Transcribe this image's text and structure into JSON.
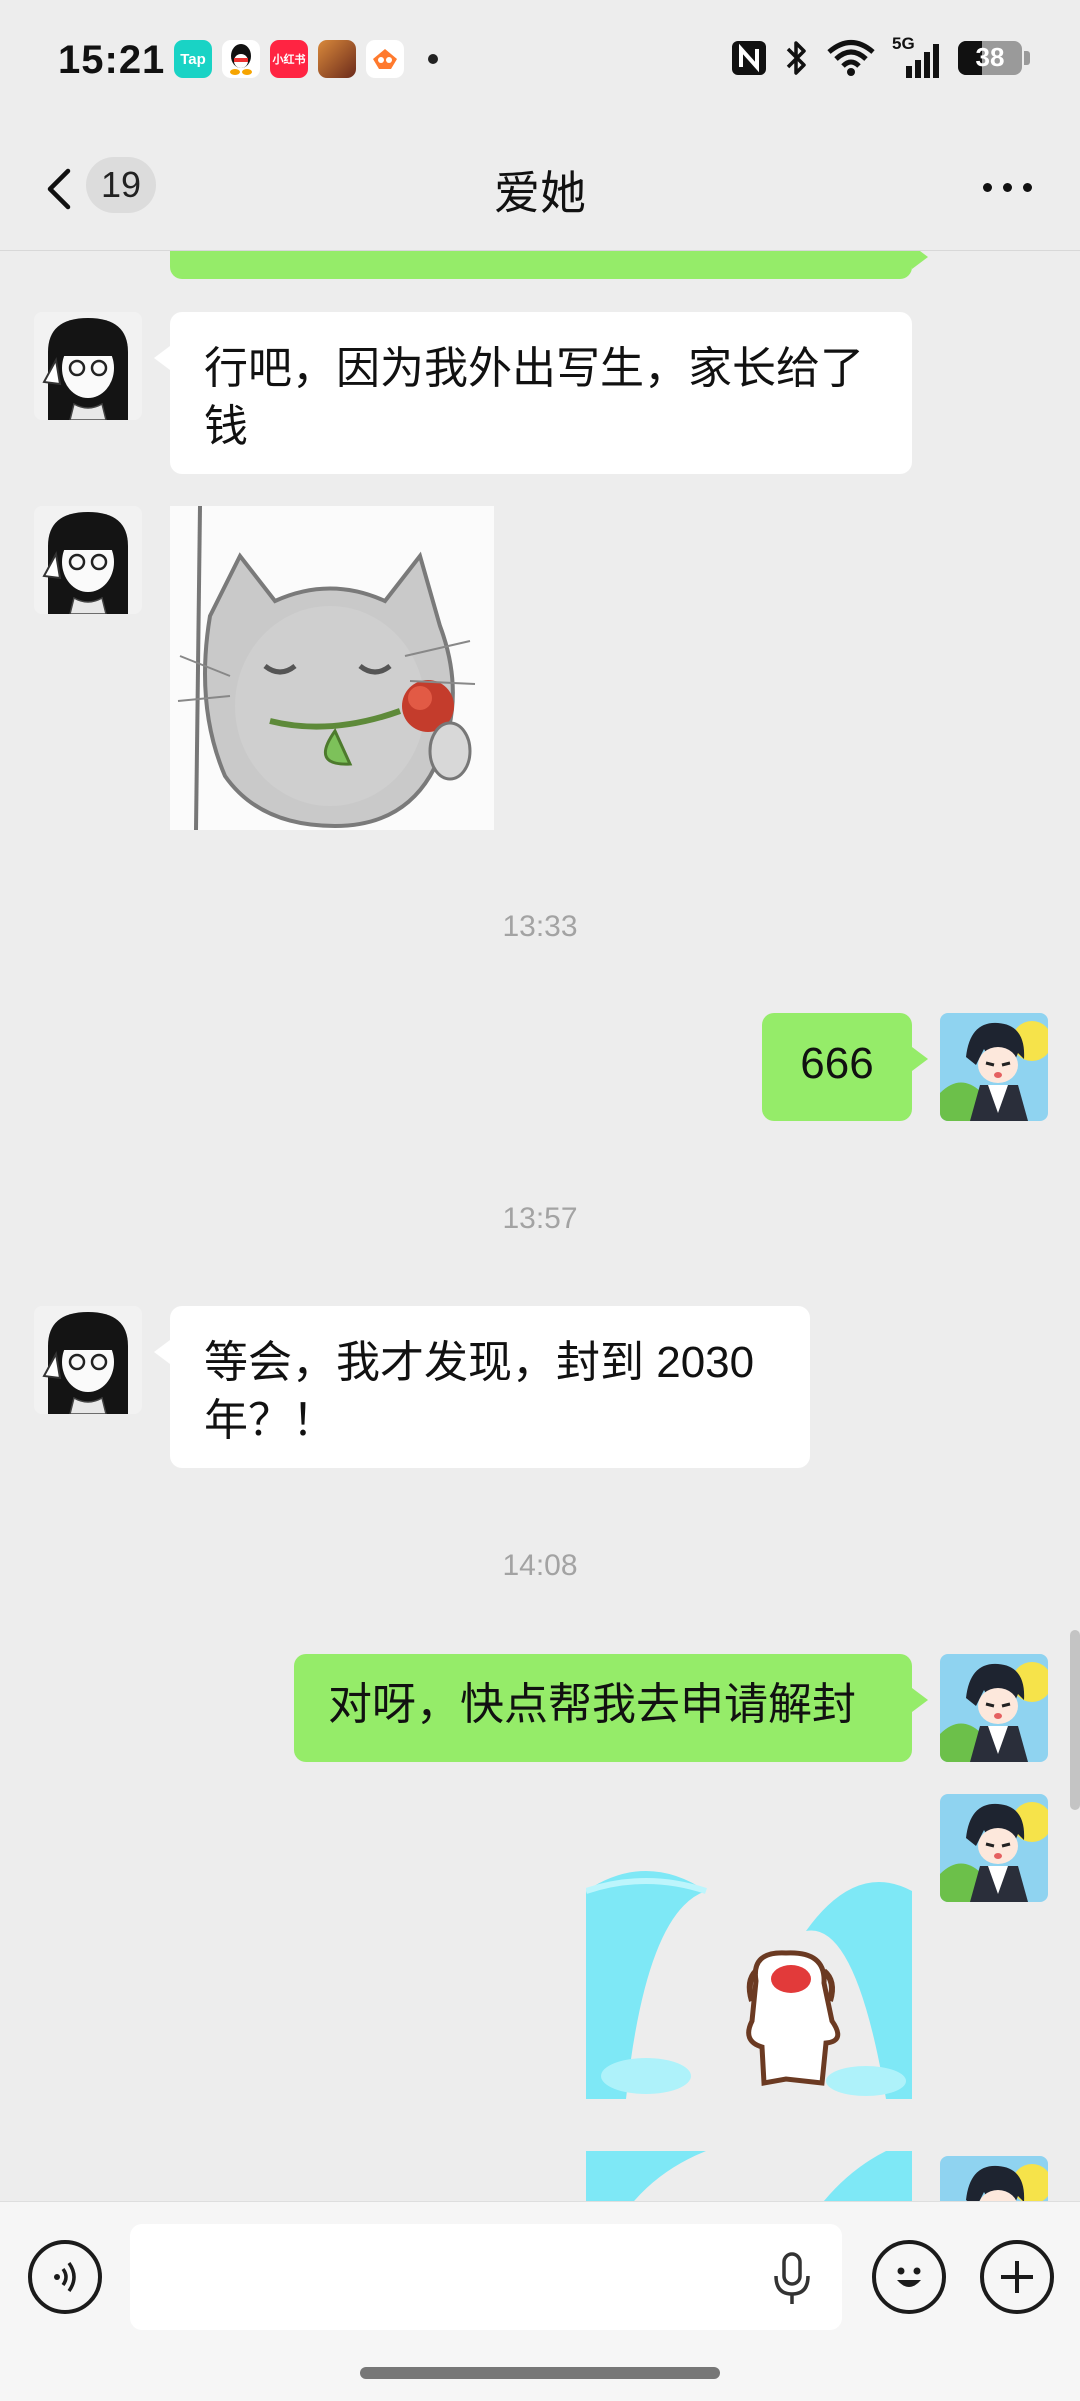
{
  "status_bar": {
    "time": "15:21",
    "notification_apps": [
      {
        "name": "taptap-icon",
        "label": "Tap",
        "color": "#19d3c5"
      },
      {
        "name": "qq-icon",
        "label": "",
        "color": "#ffffff"
      },
      {
        "name": "xiaohongshu-icon",
        "label": "小红书",
        "color": "#ff2442"
      },
      {
        "name": "game-icon",
        "label": "",
        "color": "#b55a2a"
      },
      {
        "name": "game-center-icon",
        "label": "",
        "color": "#ffffff"
      }
    ],
    "indicators": [
      "nfc-icon",
      "bluetooth-icon",
      "wifi-icon",
      "5g-signal-icon"
    ],
    "network_label": "5G",
    "battery_level": "38"
  },
  "header": {
    "back_icon": "chevron-left-icon",
    "unread_count": "19",
    "title": "爱她",
    "more_icon": "more-dots-icon"
  },
  "messages": {
    "m1_text": "行吧，因为我外出写生，家长给了钱",
    "ts1": "13:33",
    "m3_text": "666",
    "ts2": "13:57",
    "m4_text": "等会，我才发现，封到 2030 年？！",
    "ts3": "14:08",
    "m5_text": "对呀，快点帮我去申请解封",
    "sticker_cat": "cat-holding-rose-sticker",
    "sticker_crying": "crying-puppy-sticker"
  },
  "input_bar": {
    "voice_icon": "voice-mode-icon",
    "placeholder": "",
    "mic_icon": "microphone-icon",
    "emoji_icon": "emoji-icon",
    "plus_icon": "add-icon"
  },
  "colors": {
    "background": "#ededed",
    "incoming_bubble": "#ffffff",
    "outgoing_bubble": "#95ec69",
    "timestamp": "#a3a3a3"
  }
}
